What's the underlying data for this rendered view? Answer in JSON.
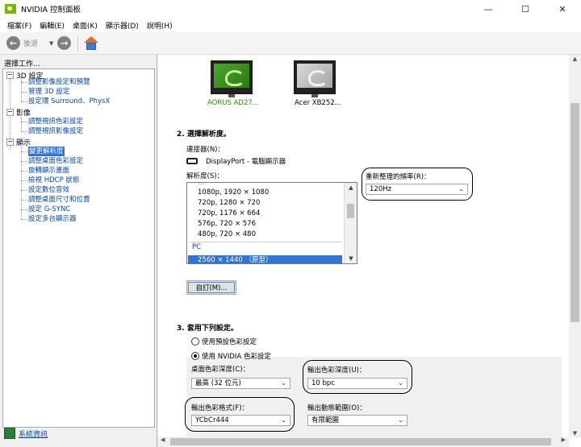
{
  "window": {
    "title": "NVIDIA 控制面板",
    "min": "—",
    "max": "☐",
    "close": "✕"
  },
  "menu": [
    "檔案(F)",
    "編輯(E)",
    "桌面(K)",
    "顯示器(D)",
    "說明(H)"
  ],
  "toolbar": {
    "back_label": "後退"
  },
  "left": {
    "task_title": "選擇工作...",
    "categories": [
      {
        "label": "3D 設定",
        "items": [
          "調整影像設定和預覽",
          "管理 3D 設定",
          "設定環 Surround、PhysX"
        ]
      },
      {
        "label": "影像",
        "items": [
          "調整視訊色彩設定",
          "調整視訊影像設定"
        ]
      },
      {
        "label": "顯示",
        "items": [
          "變更解析度",
          "調整桌面色彩設定",
          "旋轉顯示畫面",
          "檢視 HDCP 狀態",
          "設定數位音效",
          "調整桌面尺寸和位置",
          "設定 G-SYNC",
          "設定多台顯示器"
        ]
      }
    ],
    "system_info": "系統資訊"
  },
  "monitors": [
    {
      "name": "AORUS AD27...",
      "active": true
    },
    {
      "name": "Acer XB252...",
      "active": false
    }
  ],
  "section2": {
    "title": "2. 選擇解析度。",
    "connector_label": "連接器(N)：",
    "connector_value": "DisplayPort - 電腦顯示器",
    "resolution_label": "解析度(S)：",
    "resolutions": [
      "1080p, 1920 × 1080",
      "720p, 1280 × 720",
      "720p, 1176 × 664",
      "576p, 720 × 576",
      "480p, 720 × 480"
    ],
    "pc_header": "PC",
    "selected_resolution": "2560 × 1440 （原型）",
    "refresh_label": "重新整理的頻率(R)：",
    "refresh_value": "120Hz",
    "customize_button": "自訂(M)..."
  },
  "section3": {
    "title": "3. 套用下列設定。",
    "radio_default": "使用預設色彩設定",
    "radio_nvidia": "使用 NVIDIA 色彩設定",
    "desktop_depth_label": "桌面色彩深度(C)：",
    "desktop_depth_value": "最高 (32 位元)",
    "output_depth_label": "輸出色彩深度(U)：",
    "output_depth_value": "10 bpc",
    "output_format_label": "輸出色彩格式(F)：",
    "output_format_value": "YCbCr444",
    "dynamic_range_label": "輸出動態範圍(O)：",
    "dynamic_range_value": "有限範圍"
  }
}
